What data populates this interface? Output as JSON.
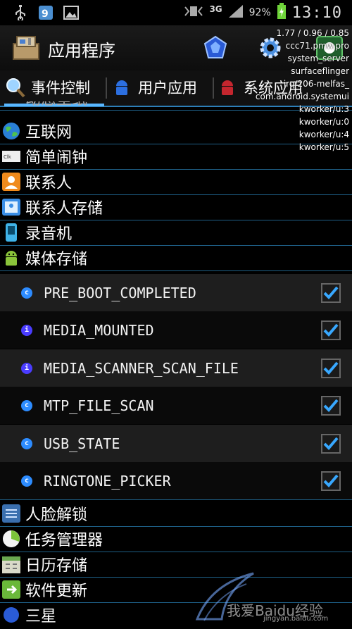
{
  "status_bar": {
    "network": "3G",
    "battery": "92%",
    "time": "13:10"
  },
  "title_bar": {
    "title": "应用程序"
  },
  "overlay": {
    "lines": [
      "1.77 / 0.96 / 0.85",
      "ccc71.pmw.pro",
      "system_server",
      "surfaceflinger",
      "irq/206-melfas_",
      "com.android.systemui",
      "kworker/u:3",
      "kworker/u:0",
      "kworker/u:4",
      "kworker/u:5"
    ]
  },
  "tabs": [
    {
      "label": "事件控制",
      "active": true
    },
    {
      "label": "用户应用",
      "active": false
    },
    {
      "label": "系统应用",
      "active": false
    }
  ],
  "list": {
    "partial_top": "动态壁纸",
    "categories_top": [
      "互联网",
      "简单闹钟",
      "联系人",
      "联系人存储",
      "录音机",
      "媒体存储"
    ],
    "events": [
      {
        "name": "PRE_BOOT_COMPLETED",
        "icon": "c",
        "checked": true
      },
      {
        "name": "MEDIA_MOUNTED",
        "icon": "i",
        "checked": true
      },
      {
        "name": "MEDIA_SCANNER_SCAN_FILE",
        "icon": "i",
        "checked": true
      },
      {
        "name": "MTP_FILE_SCAN",
        "icon": "c",
        "checked": true
      },
      {
        "name": "USB_STATE",
        "icon": "c",
        "checked": true
      },
      {
        "name": "RINGTONE_PICKER",
        "icon": "c",
        "checked": true
      }
    ],
    "categories_bottom": [
      "人脸解锁",
      "任务管理器",
      "日历存储",
      "软件更新",
      "三星"
    ]
  },
  "watermark": {
    "text": "我爱Baidu经验",
    "url": "jingyan.baidu.com"
  },
  "colors": {
    "accent": "#5ab7ff",
    "divider": "#1e5f86",
    "icon_c": "#2d8cff",
    "icon_i": "#4a3cff",
    "check": "#38a8ff"
  }
}
